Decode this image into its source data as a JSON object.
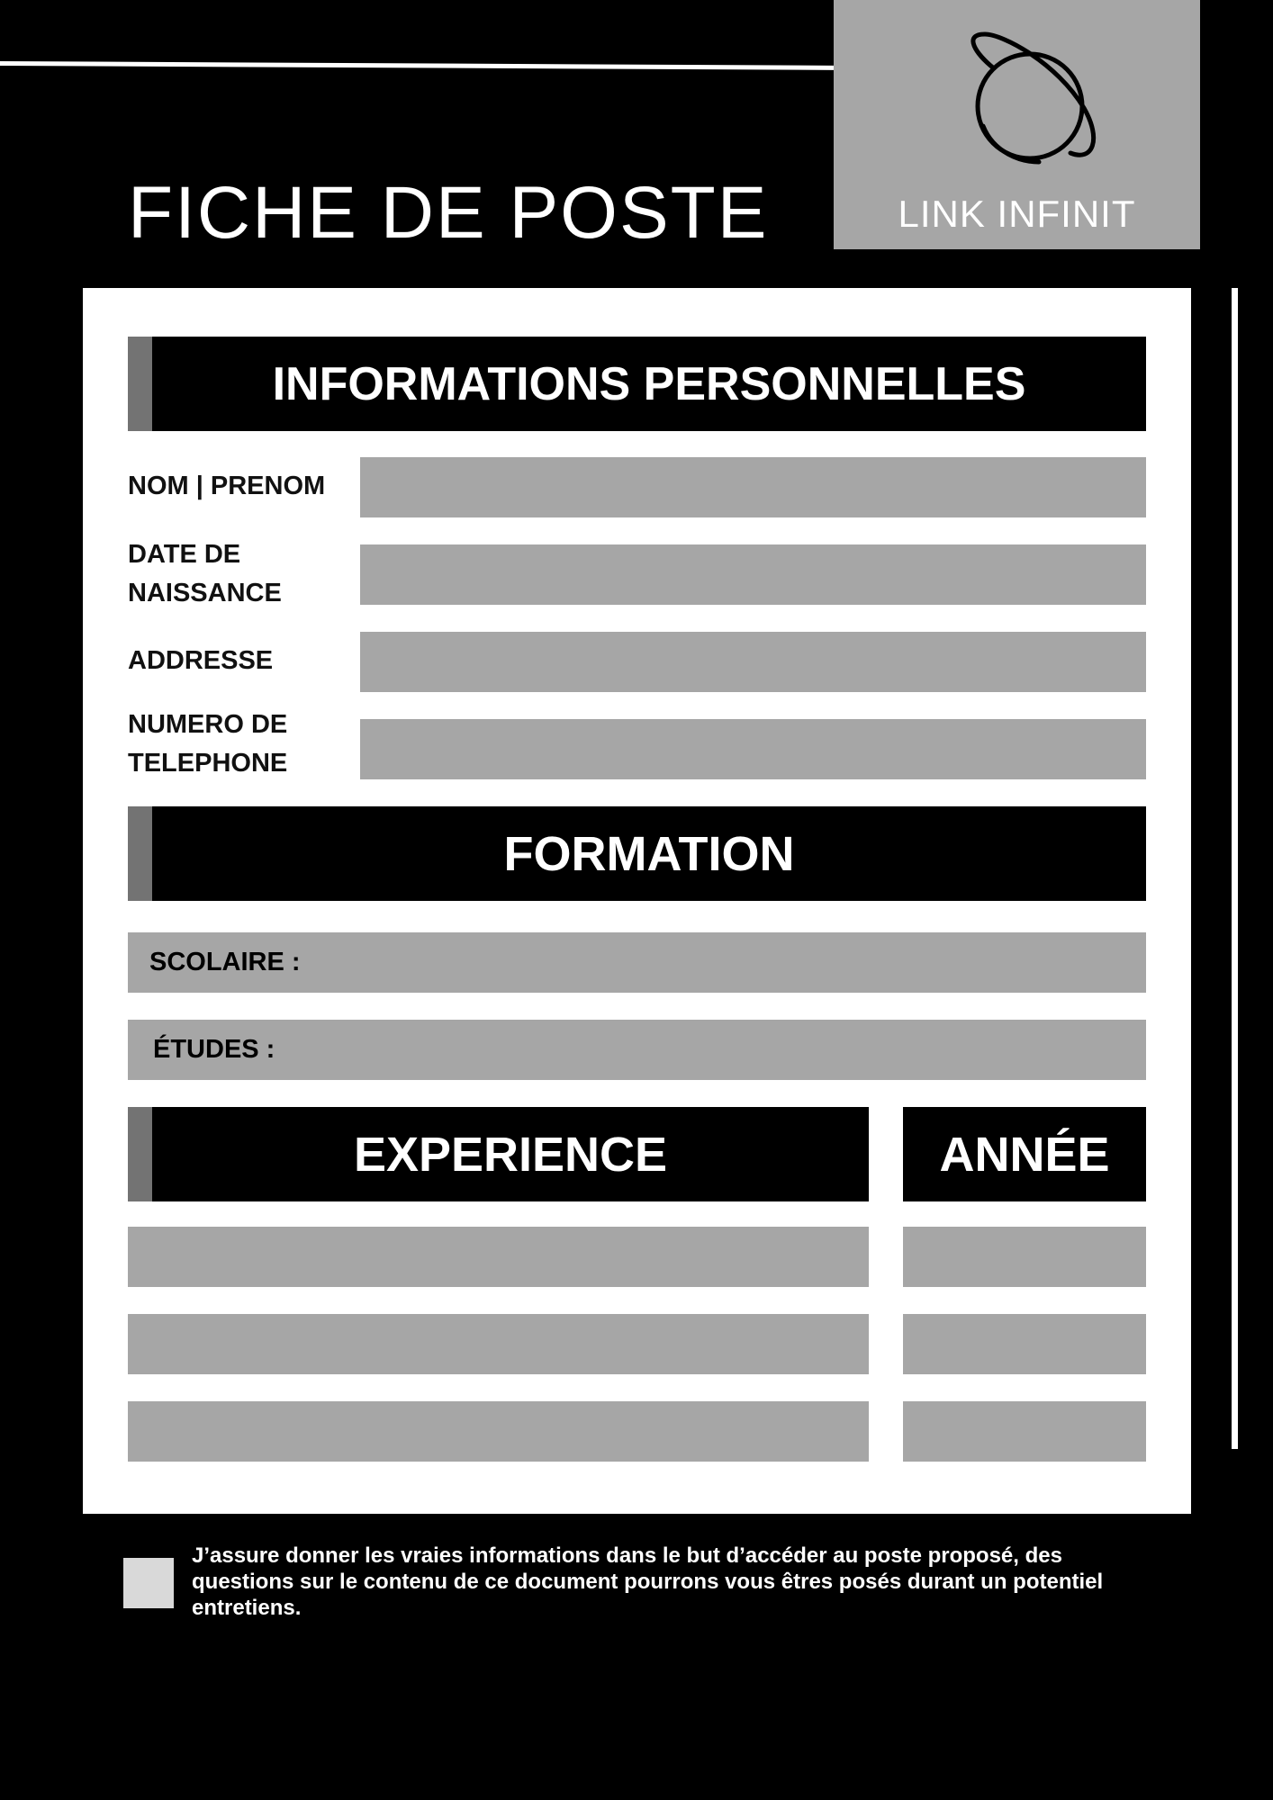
{
  "header": {
    "title": "FICHE DE POSTE",
    "logo_text": "LINK INFINIT",
    "logo_icon": "planet-ring-icon"
  },
  "colors": {
    "background": "#000000",
    "panel": "#ffffff",
    "field": "#a6a6a6",
    "accent": "#737373",
    "logo_box": "#a6a6a6",
    "checkbox": "#d9d9d9"
  },
  "personal": {
    "heading": "INFORMATIONS PERSONNELLES",
    "fields": [
      {
        "label": "NOM | PRENOM",
        "value": ""
      },
      {
        "label": "DATE DE NAISSANCE",
        "value": ""
      },
      {
        "label": "ADDRESSE",
        "value": ""
      },
      {
        "label": "NUMERO DE TELEPHONE",
        "value": ""
      }
    ]
  },
  "formation": {
    "heading": "FORMATION",
    "scolaire_label": "SCOLAIRE :",
    "etudes_label": "ÉTUDES :"
  },
  "experience": {
    "heading": "EXPERIENCE",
    "year_heading": "ANNÉE",
    "rows": [
      {
        "experience": "",
        "annee": ""
      },
      {
        "experience": "",
        "annee": ""
      },
      {
        "experience": "",
        "annee": ""
      }
    ]
  },
  "consent": {
    "checked": false,
    "text": "J’assure donner les vraies informations dans le but d’accéder au poste proposé, des questions sur le contenu de ce document pourrons vous êtres posés durant un potentiel entretiens."
  }
}
